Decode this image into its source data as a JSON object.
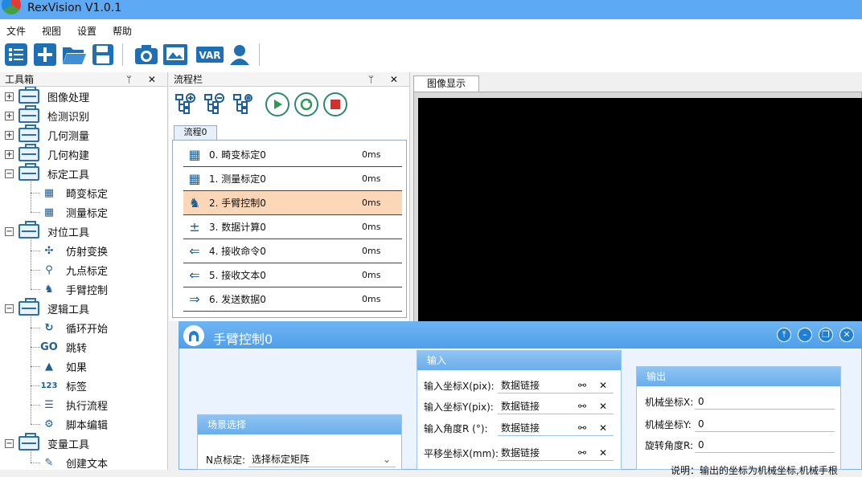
{
  "app": {
    "title": "RexVision V1.0.1"
  },
  "menu": [
    "文件",
    "视图",
    "设置",
    "帮助"
  ],
  "toolbar": {
    "icons": [
      "tasklist-icon",
      "add-icon",
      "open-folder-icon",
      "save-icon",
      "camera-icon",
      "image-display-icon",
      "var-icon",
      "user-icon",
      "run-icon",
      "loop-run-icon",
      "stop-icon"
    ],
    "var_label": "VAR"
  },
  "toolbox": {
    "title": "工具箱",
    "pins": "ᛘ ✕",
    "groups": [
      {
        "label": "图像处理",
        "expander": "+"
      },
      {
        "label": "检测识别",
        "expander": "+"
      },
      {
        "label": "几何测量",
        "expander": "+"
      },
      {
        "label": "几何构建",
        "expander": "+"
      },
      {
        "label": "标定工具",
        "expander": "−",
        "children": [
          "畸变标定",
          "测量标定"
        ]
      },
      {
        "label": "对位工具",
        "expander": "−",
        "children": [
          "仿射变换",
          "九点标定",
          "手臂控制"
        ]
      },
      {
        "label": "逻辑工具",
        "expander": "−",
        "children": [
          "循环开始",
          "跳转",
          "如果",
          "标签",
          "执行流程",
          "脚本编辑"
        ]
      },
      {
        "label": "变量工具",
        "expander": "−",
        "children": [
          "创建文本"
        ]
      }
    ],
    "go_label": "GO",
    "num_label": "123"
  },
  "flow": {
    "title": "流程栏",
    "pins": "ᛘ ✕",
    "tab": "流程0",
    "items": [
      {
        "name": "0. 畸变标定0",
        "time": "0ms"
      },
      {
        "name": "1. 测量标定0",
        "time": "0ms"
      },
      {
        "name": "2. 手臂控制0",
        "time": "0ms",
        "selected": true
      },
      {
        "name": "3. 数据计算0",
        "time": "0ms"
      },
      {
        "name": "4. 接收命令0",
        "time": "0ms"
      },
      {
        "name": "5. 接收文本0",
        "time": "0ms"
      },
      {
        "name": "6. 发送数据0",
        "time": "0ms"
      }
    ]
  },
  "image": {
    "tab": "图像显示"
  },
  "dialog": {
    "title": "手臂控制0",
    "scene": {
      "title": "场景选择",
      "label": "N点标定:",
      "value": "选择标定矩阵"
    },
    "input": {
      "title": "输入",
      "rows": [
        {
          "label": "输入坐标X(pix):",
          "value": "数据链接"
        },
        {
          "label": "输入坐标Y(pix):",
          "value": "数据链接"
        },
        {
          "label": "输入角度R  (°):",
          "value": "数据链接"
        },
        {
          "label": "平移坐标X(mm):",
          "value": "数据链接"
        }
      ]
    },
    "output": {
      "title": "输出",
      "rows": [
        {
          "label": "机械坐标X:",
          "value": "0"
        },
        {
          "label": "机械坐标Y:",
          "value": "0"
        },
        {
          "label": "旋转角度R:",
          "value": "0"
        }
      ],
      "note": "说明：输出的坐标为机械坐标,机械手根"
    }
  },
  "colors": {
    "titlebar": "#5ea9f4",
    "accent": "#1f7fd0",
    "selected_row": "#fbd7b8",
    "run_green": "#2d8a6e",
    "stop_red": "#d32f2f"
  }
}
